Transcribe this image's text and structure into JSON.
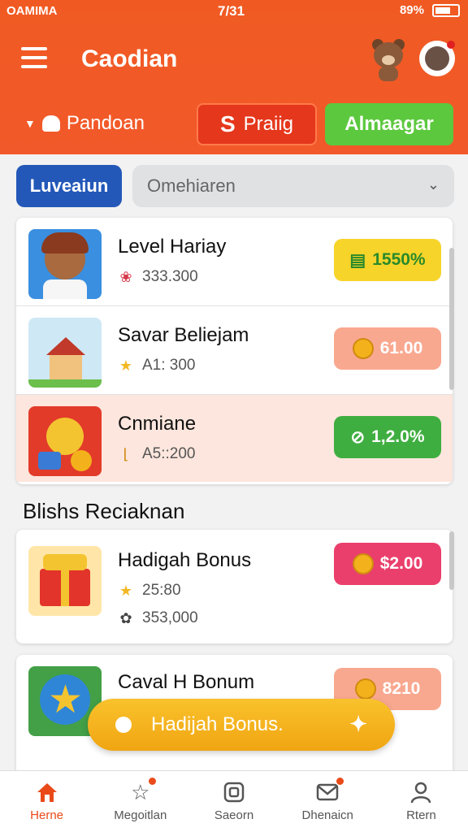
{
  "status": {
    "carrier": "OAMIMA",
    "time": "7/31",
    "battery": "89%"
  },
  "header": {
    "title": "Caodian",
    "location": "Pandoan",
    "paid_label": "Praiig",
    "paid_symbol": "S",
    "green_label": "Almaagar"
  },
  "filter": {
    "chip": "Luveaiun",
    "select_value": "Omehiaren"
  },
  "list1": [
    {
      "title": "Level Hariay",
      "sub": "333.300",
      "badge": "1550%",
      "badge_color": "#f6d42a",
      "icon": "gift-icon"
    },
    {
      "title": "Savar Beliejam",
      "sub": "A1: 300",
      "badge": "61.00",
      "badge_color": "#f9a890",
      "icon": "star-icon"
    },
    {
      "title": "Cnmiane",
      "sub": "A5::200",
      "badge": "1,2.0%",
      "badge_color": "#3fae40",
      "icon": "chart-icon"
    }
  ],
  "section_title": "Blishs Reciaknan",
  "list2": [
    {
      "title": "Hadigah Bonus",
      "sub1": "25:80",
      "sub2": "353,000",
      "badge": "$2.00",
      "badge_color": "#ea3f6c"
    },
    {
      "title": "Caval H Bonum",
      "badge": "8210",
      "badge_color": "#f9a890"
    }
  ],
  "float_banner": {
    "label": "Hadijah Bonus."
  },
  "nav": [
    {
      "label": "Herne",
      "icon": "home-icon"
    },
    {
      "label": "Megoitlan",
      "icon": "star-icon"
    },
    {
      "label": "Saeorn",
      "icon": "square-icon"
    },
    {
      "label": "Dhenaicn",
      "icon": "mail-icon"
    },
    {
      "label": "Rtern",
      "icon": "user-icon"
    }
  ],
  "colors": {
    "brand": "#f05a22",
    "accent_green": "#5cc83e",
    "chip_blue": "#2358b8"
  }
}
